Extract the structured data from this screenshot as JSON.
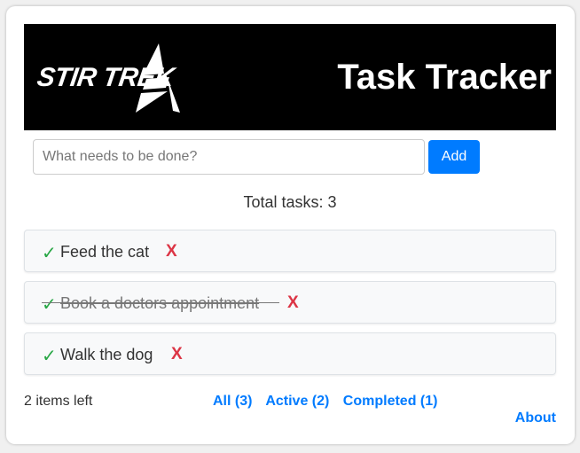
{
  "banner": {
    "logo_text": "STIR TREK",
    "title": "Task Tracker",
    "background": "#000000"
  },
  "new_task": {
    "placeholder": "What needs to be done?",
    "value": "",
    "add_label": "Add"
  },
  "summary": {
    "total_label": "Total tasks: 3"
  },
  "tasks": [
    {
      "text": "Feed the cat",
      "completed": false,
      "check_icon": "✓",
      "delete_icon": "X"
    },
    {
      "text": "Book a doctors appointment",
      "completed": true,
      "check_icon": "✓",
      "delete_icon": "X"
    },
    {
      "text": "Walk the dog",
      "completed": false,
      "check_icon": "✓",
      "delete_icon": "X"
    }
  ],
  "footer": {
    "items_left": "2 items left",
    "filters": [
      "All (3)",
      "Active (2)",
      "Completed (1)"
    ],
    "about": "About"
  },
  "colors": {
    "accent": "#007bff",
    "check": "#28a745",
    "delete": "#dc3545"
  }
}
